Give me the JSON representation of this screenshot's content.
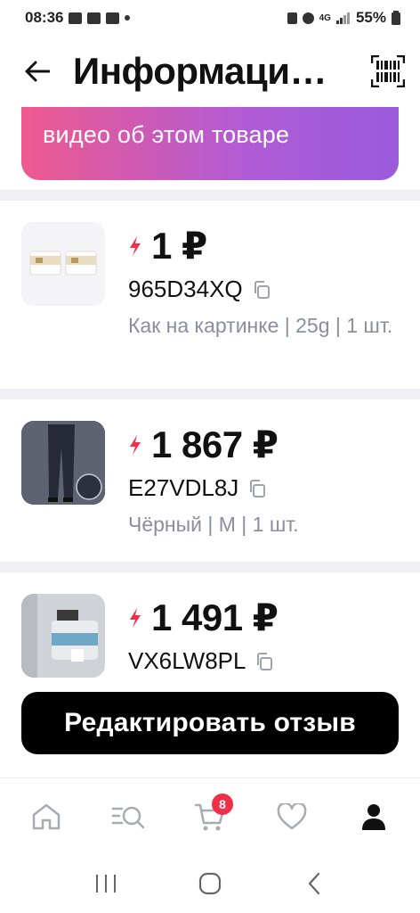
{
  "status_bar": {
    "time": "08:36",
    "battery": "55%",
    "network": "4G"
  },
  "header": {
    "title": "Информаци…",
    "back_icon": "arrow-left-icon",
    "barcode_icon": "barcode-icon"
  },
  "banner": {
    "text": "видео об этом товаре"
  },
  "items": [
    {
      "price": "1 ₽",
      "code": "965D34XQ",
      "variant": "Как на картинке | 25g | 1 шт."
    },
    {
      "price": "1 867 ₽",
      "code": "E27VDL8J",
      "variant": "Чёрный | M | 1 шт."
    },
    {
      "price": "1 491 ₽",
      "code": "VX6LW8PL",
      "variant": ""
    }
  ],
  "action": {
    "edit_review_label": "Редактировать отзыв"
  },
  "bottom_nav": {
    "items": [
      "home-icon",
      "catalog-search-icon",
      "cart-icon",
      "heart-icon",
      "profile-icon"
    ],
    "cart_badge": "8",
    "active": "profile-icon"
  },
  "colors": {
    "accent_gradient_start": "#ee5a8e",
    "accent_gradient_end": "#9a5bdc",
    "flash": "#f0304a",
    "muted_text": "#8b8e9e"
  }
}
